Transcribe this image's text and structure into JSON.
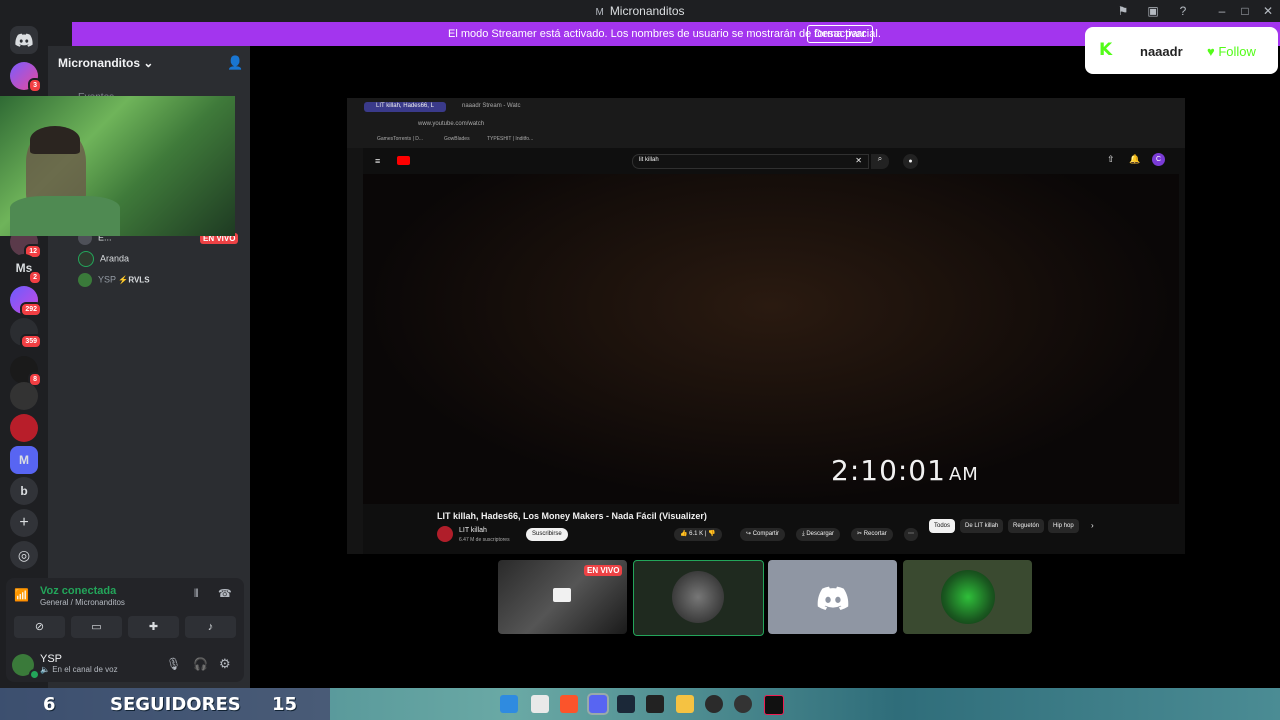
{
  "window": {
    "title": "Micronanditos",
    "icon_letter": "M"
  },
  "banner": {
    "text": "El modo Streamer está activado. Los nombres de usuario se mostrarán de forma parcial.",
    "button": "Desactivar"
  },
  "rail": {
    "badges": [
      "3",
      "12",
      "2",
      "292",
      "359",
      "8"
    ],
    "letters": {
      "ms": "Ms",
      "m": "M",
      "b": "b"
    }
  },
  "sidebar": {
    "server_name": "Micronanditos",
    "channel_partial": "Eventos",
    "users": [
      {
        "name": "E...",
        "badge": "EN VIVO"
      },
      {
        "name": "Aranda"
      },
      {
        "name": "YSP",
        "tag": "⚡RVLS"
      }
    ]
  },
  "voice": {
    "status": "Voz conectada",
    "channel": "General / Micronanditos"
  },
  "user": {
    "name": "YSP",
    "status": "En el canal de voz"
  },
  "stream": {
    "tabs": [
      "LIT killah, Hades66, L",
      "naaadr Stream - Watc"
    ],
    "url": "www.youtube.com/watch",
    "bookmarks": [
      "GamesTorrents | D...",
      "GowBlades",
      "TYPESHIT | Inditfo..."
    ],
    "search": "lit killah",
    "clock": "2:10:01",
    "clock_suffix": "AM",
    "video_title": "LIT killah, Hades66, Los Money Makers - Nada Fácil (Visualizer)",
    "channel": "LIT killah",
    "subs": "6.47 M de suscriptores",
    "subscribe": "Suscribirse",
    "likes": "6.1 K",
    "share": "Compartir",
    "download": "Descargar",
    "clip": "Recortar",
    "chips": [
      "Todos",
      "De LIT killah",
      "Reguetón",
      "Hip hop"
    ]
  },
  "tiles": {
    "live_badge": "EN VIVO"
  },
  "follow": {
    "name": "naaadr",
    "button": "Follow",
    "brand_color": "#53fc18"
  },
  "taskbar": {
    "count1": "6",
    "label": "SEGUIDORES",
    "count2": "15"
  },
  "colors": {
    "accent": "#a335ee",
    "connected": "#23a55a",
    "live": "#ed4245"
  }
}
